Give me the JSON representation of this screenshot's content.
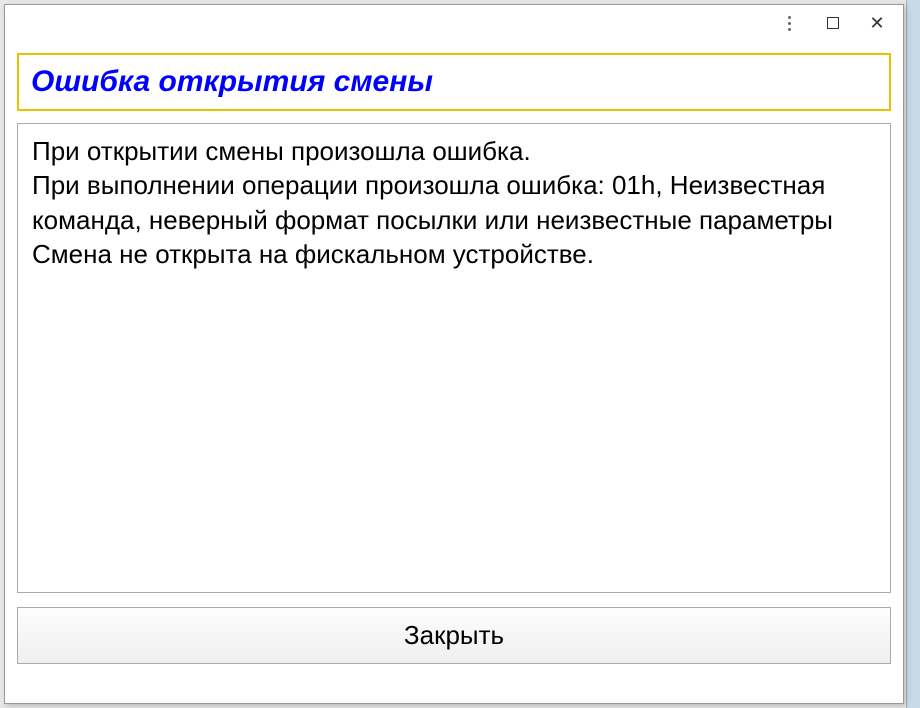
{
  "dialog": {
    "title": "Ошибка открытия смены",
    "message": "При открытии смены произошла ошибка.\nПри выполнении операции произошла ошибка: 01h, Неизвестная команда, неверный формат посылки или неизвестные параметры\nСмена не открыта на фискальном устройстве.",
    "close_label": "Закрыть"
  }
}
